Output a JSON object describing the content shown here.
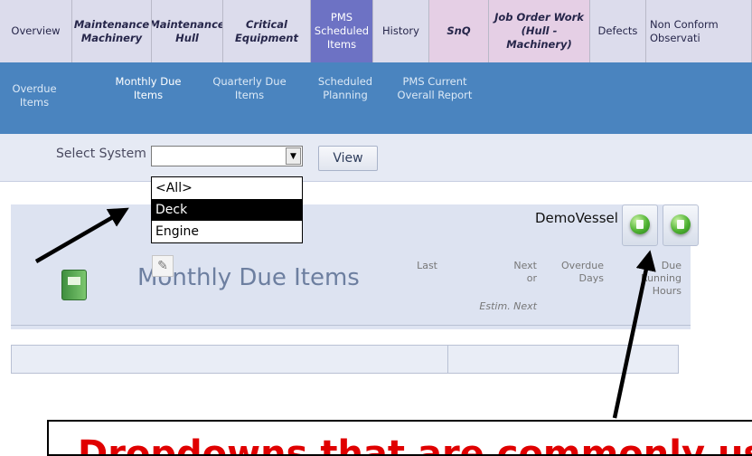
{
  "tabs": [
    {
      "label": "Overview"
    },
    {
      "label": "Maintenance Machinery"
    },
    {
      "label": "Maintenance Hull"
    },
    {
      "label": "Critical Equipment"
    },
    {
      "label": "PMS Scheduled Items"
    },
    {
      "label": "History"
    },
    {
      "label": "SnQ"
    },
    {
      "label": "Job Order Work (Hull - Machinery)"
    },
    {
      "label": "Defects"
    },
    {
      "label": "Non Conform Observati"
    }
  ],
  "subnav": [
    {
      "label": "Overdue Items"
    },
    {
      "label": "Monthly Due Items"
    },
    {
      "label": "Quarterly Due Items"
    },
    {
      "label": "Scheduled Planning"
    },
    {
      "label": "PMS Current Overall Report"
    }
  ],
  "filter": {
    "label": "Select System :",
    "selected": "",
    "view_button": "View",
    "options": [
      "<All>",
      "Deck",
      "Engine"
    ]
  },
  "panel": {
    "vessel": "DemoVessel",
    "title": "Monthly Due Items",
    "columns": {
      "last": "Last",
      "next": "Next or",
      "estim_next": "Estim. Next",
      "overdue": "Overdue Days",
      "due_running": "Due Running Hours"
    }
  },
  "annotation": {
    "text": "Dropdowns that are commonly used"
  },
  "colors": {
    "active_tab": "#6d72c4",
    "subnav": "#4a84bf",
    "annotation_text": "#e00000"
  }
}
